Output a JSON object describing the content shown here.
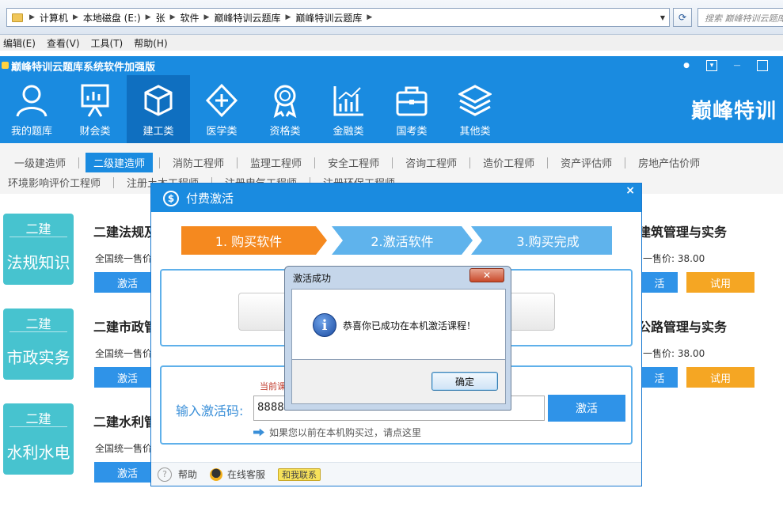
{
  "explorer": {
    "path": [
      "计算机",
      "本地磁盘 (E:)",
      "张",
      "软件",
      "巅峰特训云题库",
      "巅峰特训云题库"
    ],
    "search_placeholder": "搜索 巅峰特训云题库",
    "menu": [
      "编辑(E)",
      "查看(V)",
      "工具(T)",
      "帮助(H)"
    ]
  },
  "app": {
    "title": "巅峰特训云题库系统软件加强版",
    "brand": "巅峰特训",
    "nav": [
      {
        "label": "我的题库",
        "icon": "user-icon"
      },
      {
        "label": "财会类",
        "icon": "presentation-icon"
      },
      {
        "label": "建工类",
        "icon": "cube-icon"
      },
      {
        "label": "医学类",
        "icon": "medical-cross-icon"
      },
      {
        "label": "资格类",
        "icon": "award-icon"
      },
      {
        "label": "金融类",
        "icon": "chart-icon"
      },
      {
        "label": "国考类",
        "icon": "briefcase-icon"
      },
      {
        "label": "其他类",
        "icon": "layers-icon"
      }
    ],
    "active_nav": "建工类",
    "subnav_row1": [
      "一级建造师",
      "二级建造师",
      "消防工程师",
      "监理工程师",
      "安全工程师",
      "咨询工程师",
      "造价工程师",
      "资产评估师",
      "房地产估价师"
    ],
    "subnav_row2": [
      "环境影响评价工程师",
      "注册土木工程师",
      "注册电气工程师",
      "注册环保工程师"
    ],
    "active_sub": "二级建造师",
    "tiles": [
      {
        "top": "二建",
        "bottom": "法规知识"
      },
      {
        "top": "二建",
        "bottom": "市政实务"
      },
      {
        "top": "二建",
        "bottom": "水利水电"
      }
    ],
    "courses_left": [
      "二建法规及",
      "二建市政管",
      "二建水利管"
    ],
    "courses_right": [
      "建筑管理与实务",
      "公路管理与实务"
    ],
    "price_left": "全国统一售价",
    "price_right": "一售价: 38.00",
    "btn_activate": "激活",
    "btn_activate_short": "活",
    "btn_trial": "试用"
  },
  "pay_dialog": {
    "title": "付费激活",
    "close": "×",
    "steps": [
      "1. 购买软件",
      "2.激活软件",
      "3.购买完成"
    ],
    "current_tip": "当前课",
    "code_label": "输入激活码:",
    "code_value": "8888",
    "code_btn": "激活",
    "bought_link": "如果您以前在本机购买过，请点这里",
    "footer_help": "帮助",
    "footer_service": "在线客服",
    "footer_contact": "和我联系"
  },
  "msgbox": {
    "title": "激活成功",
    "close": "✕",
    "text": "恭喜你已成功在本机激活课程！",
    "ok": "确定"
  }
}
